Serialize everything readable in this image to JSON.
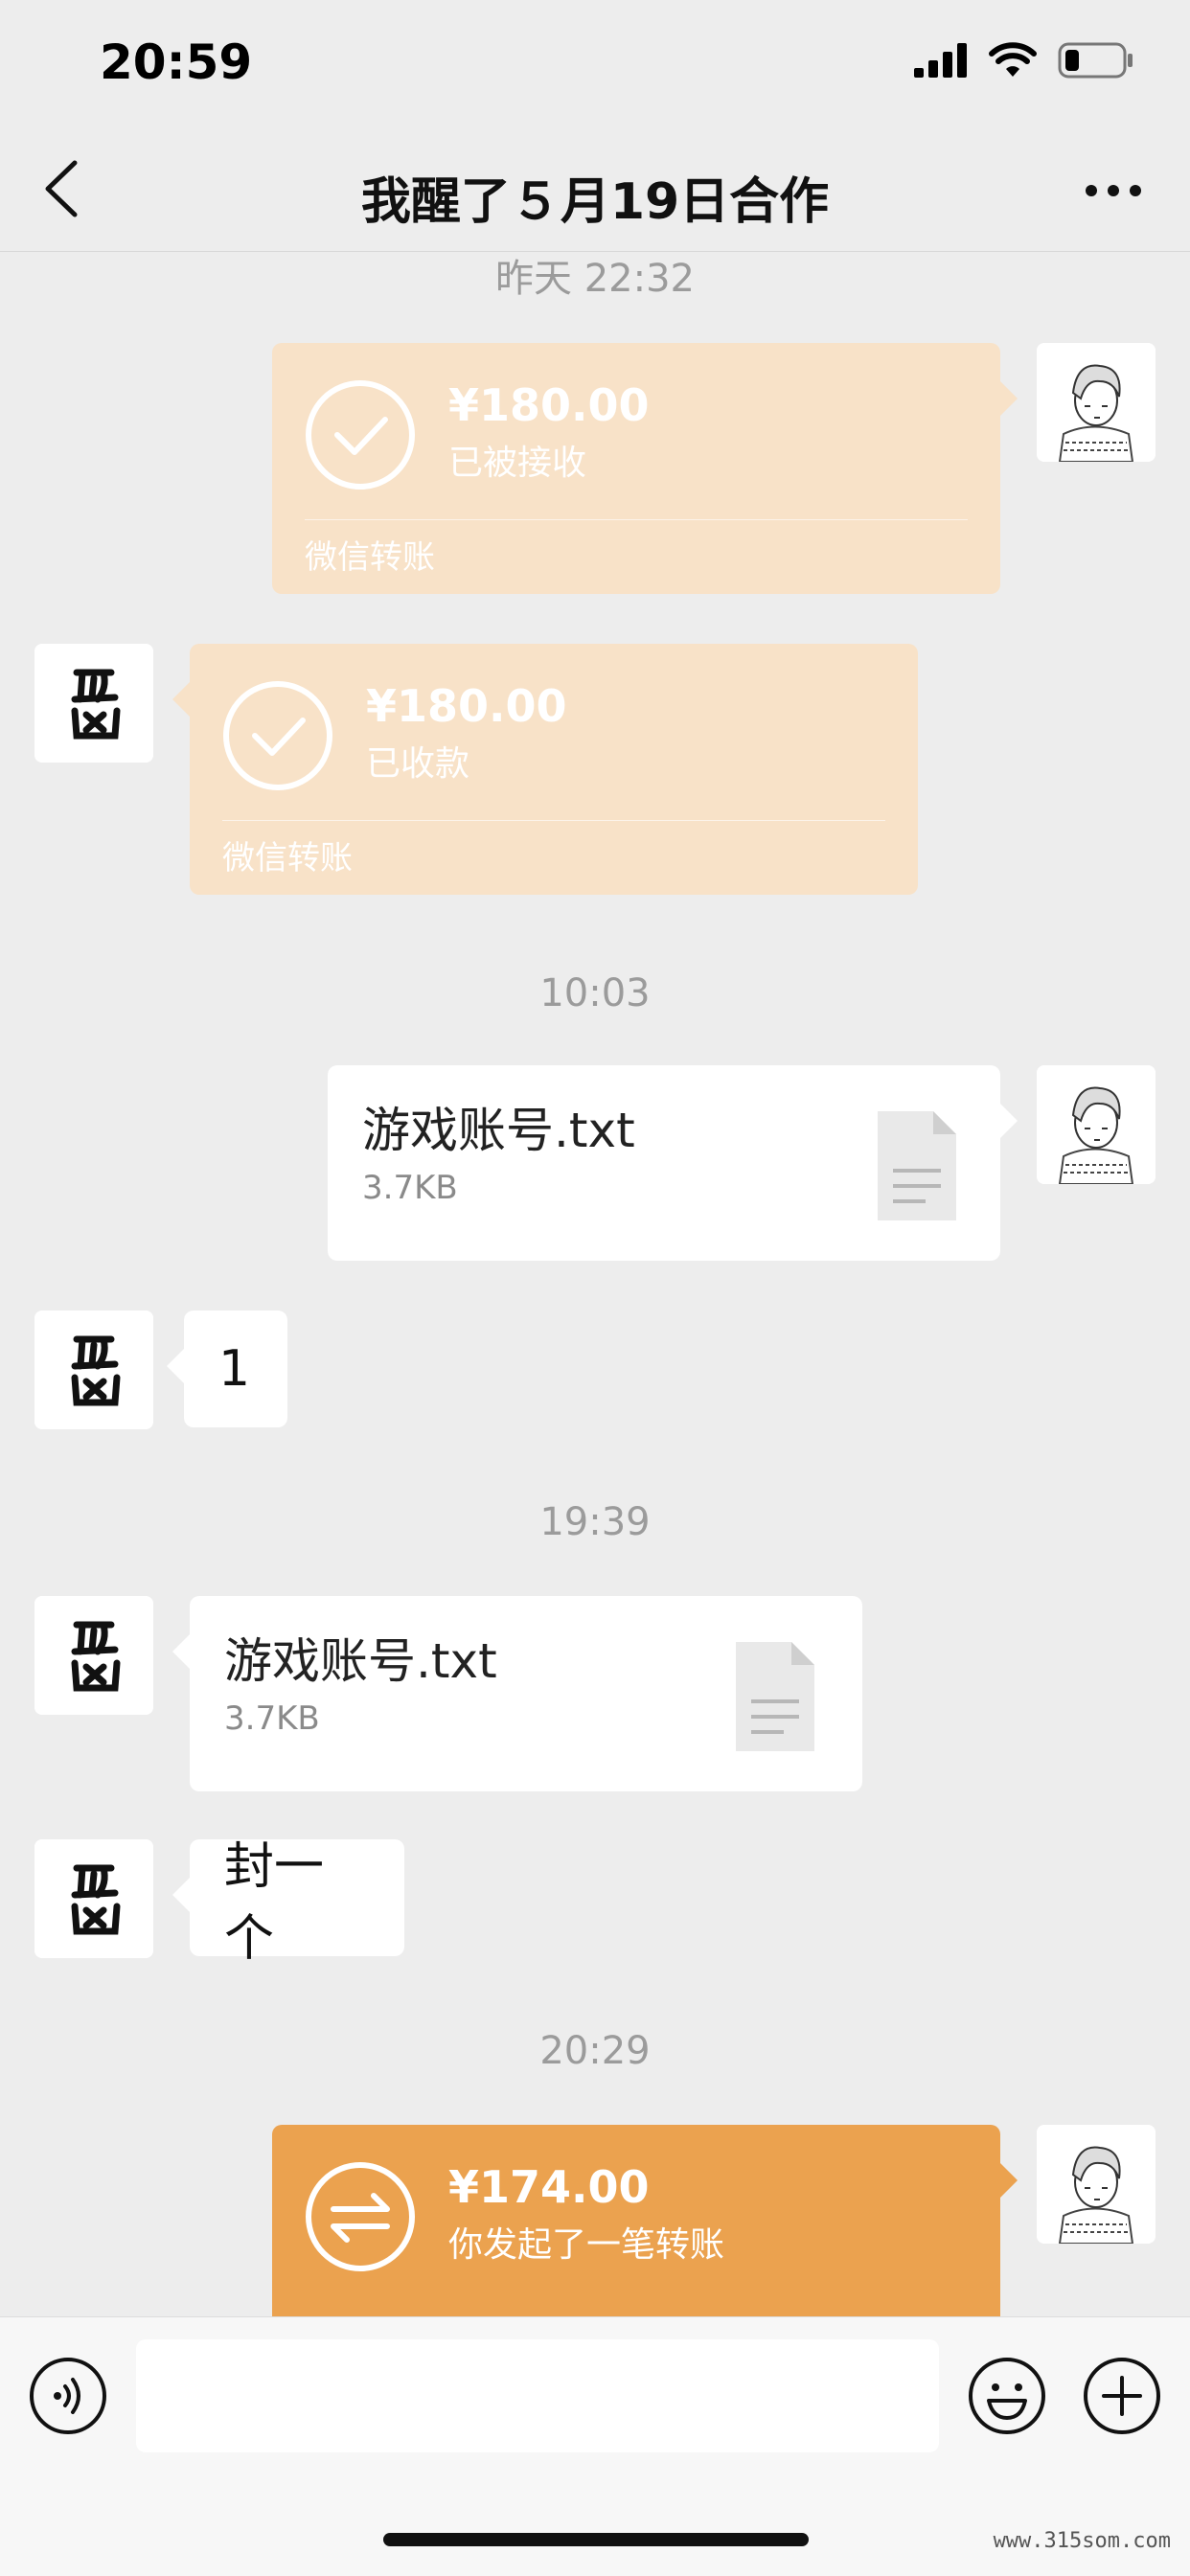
{
  "status_bar": {
    "time": "20:59"
  },
  "header": {
    "title": "我醒了５月19日合作"
  },
  "colors": {
    "transfer_done": "#f8e2c8",
    "transfer_active": "#eba24f",
    "background": "#ededed"
  },
  "messages": [
    {
      "timestamp": "昨天 22:32"
    },
    {
      "side": "right",
      "type": "transfer",
      "amount": "¥180.00",
      "status": "已被接收",
      "label": "微信转账",
      "icon": "check-icon"
    },
    {
      "side": "left",
      "type": "transfer",
      "amount": "¥180.00",
      "status": "已收款",
      "label": "微信转账",
      "icon": "check-icon"
    },
    {
      "timestamp": "10:03"
    },
    {
      "side": "right",
      "type": "file",
      "name": "游戏账号.txt",
      "size": "3.7KB",
      "icon": "document-icon"
    },
    {
      "side": "left",
      "type": "text",
      "text": "1"
    },
    {
      "timestamp": "19:39"
    },
    {
      "side": "left",
      "type": "file",
      "name": "游戏账号.txt",
      "size": "3.7KB",
      "icon": "document-icon"
    },
    {
      "side": "left",
      "type": "text",
      "text": "封一个"
    },
    {
      "timestamp": "20:29"
    },
    {
      "side": "right",
      "type": "transfer",
      "amount": "¥174.00",
      "status": "你发起了一笔转账",
      "icon": "transfer-arrows-icon"
    }
  ],
  "avatars": {
    "left": "超凶",
    "right": "sketch-boy-avatar"
  },
  "toolbar": {
    "voice": "voice-icon",
    "emoji": "emoji-icon",
    "add": "plus-icon"
  },
  "watermark": "www.315som.com"
}
